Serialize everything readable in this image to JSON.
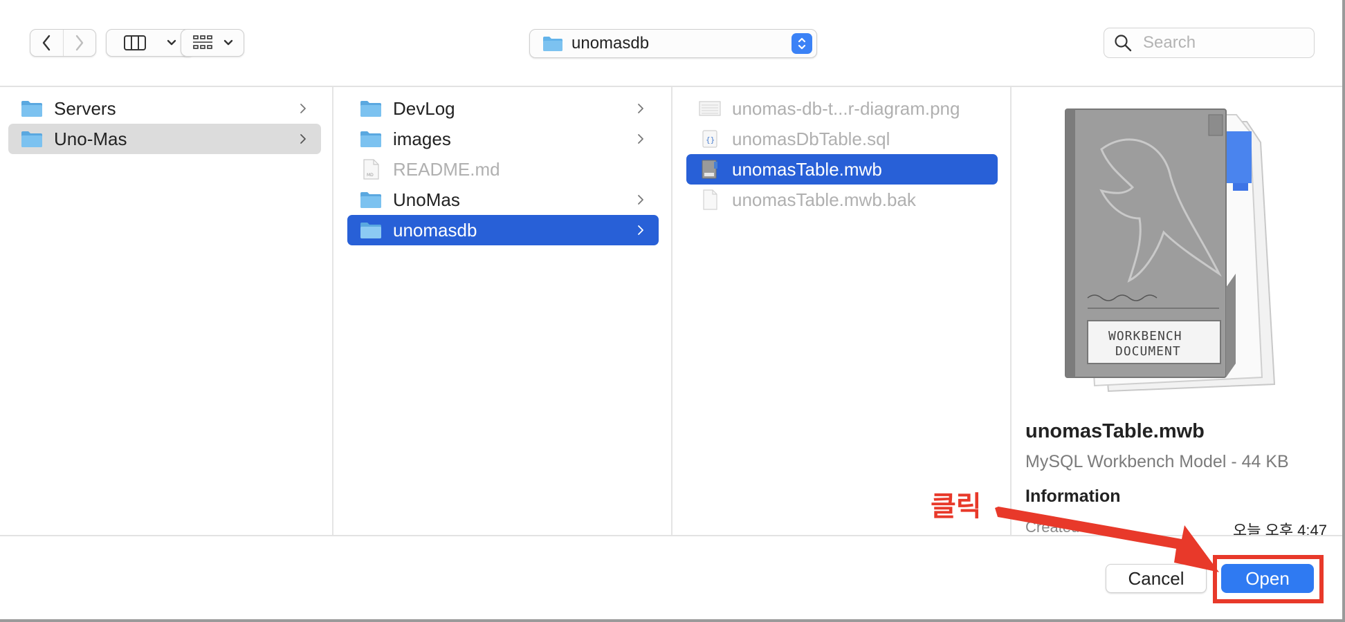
{
  "toolbar": {
    "path_label": "unomasdb",
    "search_placeholder": "Search"
  },
  "sidebar_column": {
    "items": [
      {
        "label": "Servers",
        "icon": "folder-icon"
      },
      {
        "label": "Uno-Mas",
        "icon": "folder-icon"
      }
    ]
  },
  "repo_column": {
    "items": [
      {
        "label": "DevLog",
        "icon": "folder-icon"
      },
      {
        "label": "images",
        "icon": "folder-icon"
      },
      {
        "label": "README.md",
        "icon": "file-icon"
      },
      {
        "label": "UnoMas",
        "icon": "folder-icon"
      },
      {
        "label": "unomasdb",
        "icon": "folder-icon"
      }
    ]
  },
  "files_column": {
    "items": [
      {
        "label": "unomas-db-t...r-diagram.png",
        "icon": "image-file-icon"
      },
      {
        "label": "unomasDbTable.sql",
        "icon": "sql-file-icon"
      },
      {
        "label": "unomasTable.mwb",
        "icon": "mwb-file-icon"
      },
      {
        "label": "unomasTable.mwb.bak",
        "icon": "blank-file-icon"
      }
    ]
  },
  "preview": {
    "filename": "unomasTable.mwb",
    "kind": "MySQL Workbench Model - 44 KB",
    "info_heading": "Information",
    "created_label": "Created",
    "created_value": "오늘 오후 4:47",
    "doc_label_line1": "WORKBENCH",
    "doc_label_line2": "DOCUMENT"
  },
  "buttons": {
    "cancel": "Cancel",
    "open": "Open"
  },
  "annotation": {
    "text": "클릭",
    "color": "#e8392a"
  },
  "colors": {
    "selection_blue": "#2860d7",
    "selection_gray": "#dcdcdc",
    "open_button": "#2f7af2",
    "folder_blue": "#62b3ea"
  }
}
